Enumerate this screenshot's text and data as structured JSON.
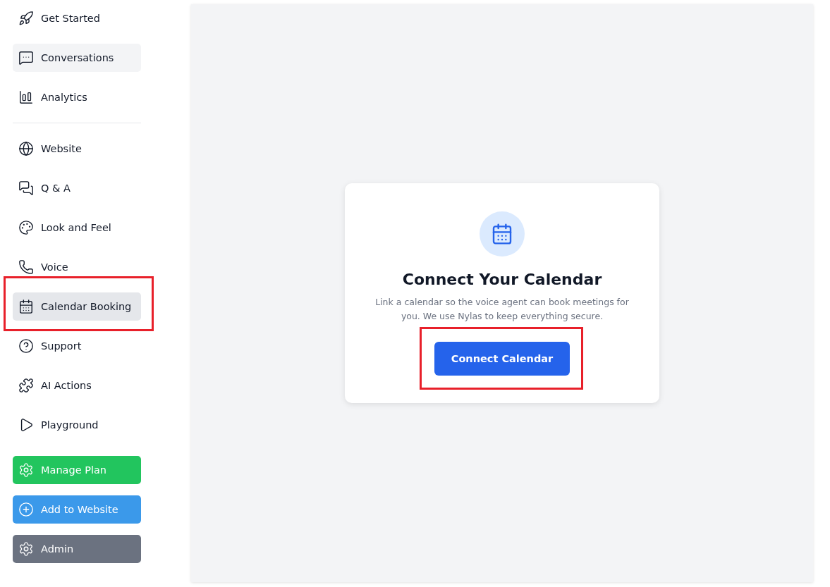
{
  "sidebar": {
    "sections": [
      {
        "items": [
          {
            "label": "Get Started",
            "selected": false,
            "hovered": false,
            "highlighted": false
          },
          {
            "label": "Conversations",
            "selected": false,
            "hovered": true,
            "highlighted": false
          },
          {
            "label": "Analytics",
            "selected": false,
            "hovered": false,
            "highlighted": false
          }
        ]
      },
      {
        "items": [
          {
            "label": "Website",
            "selected": false,
            "hovered": false,
            "highlighted": false
          },
          {
            "label": "Q & A",
            "selected": false,
            "hovered": false,
            "highlighted": false
          },
          {
            "label": "Look and Feel",
            "selected": false,
            "hovered": false,
            "highlighted": false
          },
          {
            "label": "Voice",
            "selected": false,
            "hovered": false,
            "highlighted": false
          },
          {
            "label": "Calendar Booking",
            "selected": true,
            "hovered": false,
            "highlighted": true
          },
          {
            "label": "Support",
            "selected": false,
            "hovered": false,
            "highlighted": false
          },
          {
            "label": "AI Actions",
            "selected": false,
            "hovered": false,
            "highlighted": false
          },
          {
            "label": "Playground",
            "selected": false,
            "hovered": false,
            "highlighted": false
          }
        ]
      }
    ],
    "action_buttons": [
      {
        "label": "Manage Plan",
        "color": "#22c55e"
      },
      {
        "label": "Add to Website",
        "color": "#3b99ea"
      },
      {
        "label": "Admin",
        "color": "#6b7280"
      }
    ]
  },
  "card": {
    "title": "Connect Your Calendar",
    "description": "Link a calendar so the voice agent can book meetings for you. We use Nylas to keep everything secure.",
    "button": {
      "label": "Connect Calendar",
      "highlighted": true
    }
  }
}
